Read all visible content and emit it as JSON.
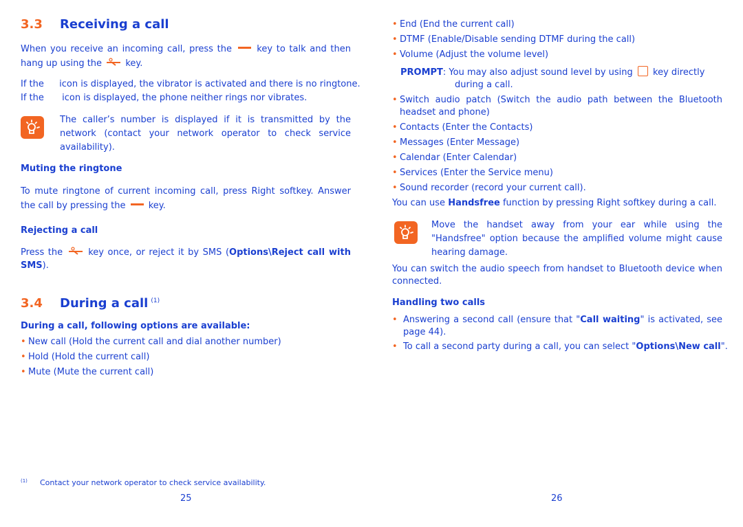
{
  "left_page": {
    "section_33": {
      "number": "3.3",
      "title": "Receiving a call"
    },
    "receive_text": {
      "part1": "When you receive an incoming call, press the",
      "part2": "key to talk and then hang up using the",
      "part3": "key."
    },
    "vibrate_line": {
      "a": "If the",
      "b": "icon is displayed, the vibrator is activated and there is no ringtone."
    },
    "silent_line": {
      "a": "If the",
      "b": "icon is displayed, the phone neither rings nor vibrates."
    },
    "tip1": "The caller’s number is displayed if it is transmitted by the network (contact your network operator to check service availability).",
    "muting": {
      "heading": "Muting the ringtone",
      "text1": "To mute ringtone of current incoming call, press Right softkey. Answer the call by pressing the",
      "text2": "key."
    },
    "rejecting": {
      "heading": "Rejecting a call",
      "text1": "Press the",
      "text2": "key once, or reject it by SMS (",
      "bold": "Options\\Reject call with SMS",
      "text3": ")."
    },
    "section_34": {
      "number": "3.4",
      "title": "During a call",
      "footnote_ref": "(1)"
    },
    "options_heading": "During a call, following options are available:",
    "options": [
      "New call (Hold the current call and dial another number)",
      "Hold (Hold the current call)",
      "Mute (Mute the current call)"
    ],
    "footnote": {
      "marker": "(1)",
      "text": "Contact your network operator to check service availability."
    },
    "page_number": "25"
  },
  "right_page": {
    "options_top": [
      "End (End the current call)",
      "DTMF (Enable/Disable sending DTMF during the call)",
      "Volume (Adjust the volume level)"
    ],
    "prompt": {
      "label": "PROMPT",
      "text1": ": You may also adjust sound level by using",
      "text2": "key directly",
      "text3": "during a call."
    },
    "options_bottom": [
      "Switch audio patch (Switch the audio path between the Bluetooth headset and phone)",
      "Contacts (Enter the Contacts)",
      "Messages (Enter Message)",
      "Calendar (Enter Calendar)",
      "Services (Enter the Service menu)",
      "Sound recorder (record your current call)."
    ],
    "handsfree": {
      "text1": "You can use",
      "bold": "Handsfree",
      "text2": "function by pressing Right softkey during a call."
    },
    "tip2": "Move the handset away from your ear while using the \"Handsfree\" option because the amplified volume might cause hearing damage.",
    "bluetooth_text": "You can switch the audio speech from handset to Bluetooth device when connected.",
    "two_calls": {
      "heading": "Handling two calls",
      "item1": {
        "text1": "Answering a second call (ensure that \"",
        "bold": "Call waiting",
        "text2": "\" is activated, see page 44)."
      },
      "item2": {
        "text1": "To call a second party during a call, you can select \"",
        "bold": "Options\\New call",
        "text2": "\"."
      }
    },
    "page_number": "26"
  },
  "colors": {
    "text_blue": "#1a3fd0",
    "accent_orange": "#f26522"
  },
  "bullet_glyph": "•"
}
